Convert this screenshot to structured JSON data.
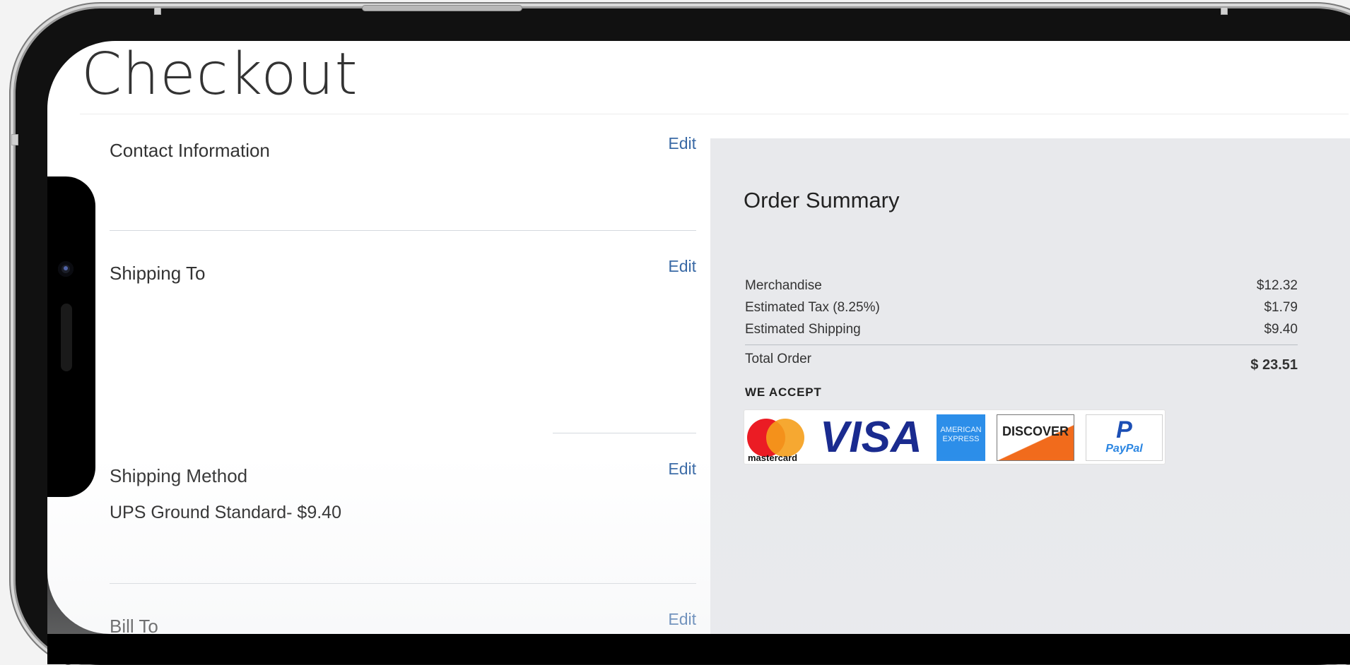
{
  "page": {
    "title": "Checkout"
  },
  "sections": {
    "contact_information": {
      "title": "Contact Information",
      "edit_label": "Edit"
    },
    "shipping_to": {
      "title": "Shipping To",
      "edit_label": "Edit"
    },
    "shipping_method": {
      "title": "Shipping Method",
      "edit_label": "Edit",
      "value": "UPS Ground Standard- $9.40"
    },
    "bill_to": {
      "title": "Bill To",
      "edit_label": "Edit"
    }
  },
  "order_summary": {
    "title": "Order Summary",
    "rows": [
      {
        "label": "Merchandise",
        "amount": "$12.32"
      },
      {
        "label": "Estimated Tax (8.25%)",
        "amount": "$1.79"
      },
      {
        "label": "Estimated Shipping",
        "amount": "$9.40"
      }
    ],
    "total_label": "Total Order",
    "total_amount": "$ 23.51",
    "we_accept_label": "WE ACCEPT",
    "payment_methods": {
      "mastercard": "mastercard",
      "visa": "VISA",
      "amex": "AMERICAN EXPRESS",
      "discover": "DISCOVER",
      "paypal": "PayPal"
    }
  },
  "colors": {
    "link": "#3a6aa6",
    "summary_bg": "#e8e9ec",
    "mastercard_red": "#eb1c24",
    "mastercard_orange": "#f59e1b",
    "visa_blue": "#1a2b8f",
    "amex_blue": "#2c8ee9",
    "discover_orange": "#f16b1c",
    "paypal_blue": "#1c4fb5"
  }
}
